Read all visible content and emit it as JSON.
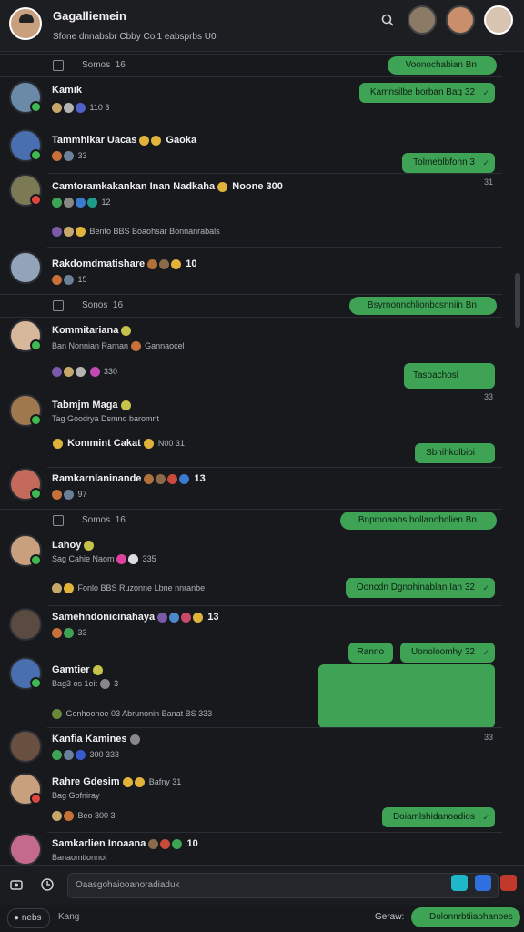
{
  "header": {
    "title": "Gagalliemein",
    "subtitle": "Sfone dnnabsbr  Cbby  Coi1  eabsprbs  U0"
  },
  "sections": [
    {
      "label": "Somos",
      "count": "16",
      "pill": "Voonochabian Bn"
    },
    {
      "label": "Sonos",
      "count": "16",
      "pill": "Bsyrnonnchlionbcsnniin Bn"
    },
    {
      "label": "Somos",
      "count": "16",
      "pill": "Bnpmoaabs bollanobdlien Bn"
    }
  ],
  "rows": [
    {
      "name": "Kamik",
      "sub": "110  3",
      "bubble": "Kamnsilbe borban Bag 32",
      "time": ""
    },
    {
      "name": "Tammhikar Uacas",
      "name_tail": "Gaoka",
      "sub": "33",
      "bubble": "Tolmeblbfonn 3",
      "time": ""
    },
    {
      "name": "Camtoramkakankan Inan Nadkaha",
      "name_tail": "Noone  300",
      "sub": "12",
      "bubble": "",
      "time": "31"
    },
    {
      "name": "",
      "sub": "Bento  BBS  Boaohsar Bonnanrabals",
      "bubble": "",
      "time": ""
    },
    {
      "name": "Rakdomdmatishare",
      "sub": "15",
      "extra": "10",
      "bubble": "",
      "time": ""
    },
    {
      "name": "Kommitariana",
      "sub": "Ban Nonnian Rarnan",
      "sub_tail": "Gannaocel",
      "bubble": "Tasoachosl",
      "extra": "330",
      "time": "33"
    },
    {
      "name": "Tabmjm Maga",
      "sub": "Tag  Goodrya   Dsmno baromnt",
      "bubble": "Sbnihkolbioi",
      "time": ""
    },
    {
      "name": "Kommint Cakat",
      "sub": "N00  31",
      "bubble": "",
      "time": ""
    },
    {
      "name": "Ramkarnlaninande",
      "sub": "97",
      "extra": "13",
      "bubble": "",
      "time": ""
    },
    {
      "name": "Lahoy",
      "sub": "Sag Cahie Naom",
      "sub_tail": "335",
      "bubble": "",
      "time": ""
    },
    {
      "name": "",
      "sub": "Fonlo  BBS  Ruzonne  Lbne nnranbe",
      "bubble": "Ooncdn Dgnohinablan Ian 32",
      "time": ""
    },
    {
      "name": "Samehndonicinahaya",
      "sub": "33",
      "extra": "13",
      "bubble": "Ranno",
      "bubble2": "Uonoloomhy 32",
      "time": ""
    },
    {
      "name": "Gamtier",
      "sub": "Bag3 os  1eit",
      "sub_tail": "3",
      "bubble": "",
      "time": "33"
    },
    {
      "name": "",
      "sub": "Gonhoonoe 03   Abrunonin  Banat  BS  333",
      "bubble": "",
      "time": ""
    },
    {
      "name": "Kanfia Kamines",
      "sub": "300  333",
      "bubble": "",
      "time": ""
    },
    {
      "name": "Rahre Gdesim",
      "name_tail": "Bafny  31",
      "sub": "Bag Gofniray",
      "bubble": "",
      "time": ""
    },
    {
      "name": "",
      "sub": "Beo  300  3",
      "bubble": "Doiamlshidanoadios",
      "time": ""
    },
    {
      "name": "Samkarlien Inoaana",
      "sub": "Banaomtionnot",
      "extra": "10",
      "bubble": "",
      "time": ""
    }
  ],
  "compose": {
    "placeholder": "Oaasgohaiooanoradiaduk"
  },
  "footer": {
    "left_label": "nebs",
    "left_text": "Kang",
    "right_label": "Geraw:",
    "right_pill": "Dolonnrbtiiaohanoes"
  },
  "colors": {
    "bg": "#17191d",
    "accent": "#3fa356",
    "online": "#3fb950"
  }
}
